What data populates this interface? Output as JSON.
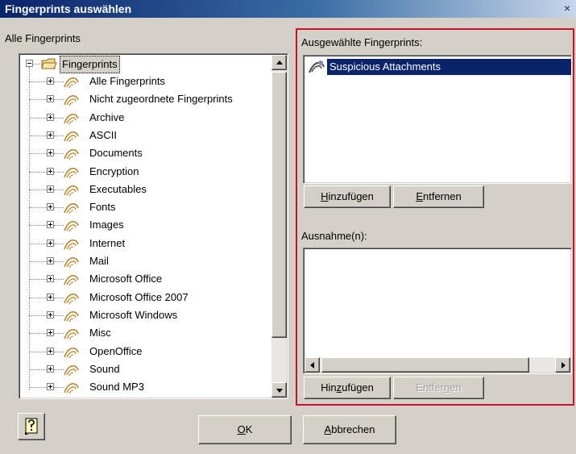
{
  "window": {
    "title": "Fingerprints auswählen",
    "close_glyph": "×"
  },
  "left": {
    "label": "Alle Fingerprints",
    "root": "Fingerprints",
    "items": [
      "Alle Fingerprints",
      "Nicht zugeordnete Fingerprints",
      "Archive",
      "ASCII",
      "Documents",
      "Encryption",
      "Executables",
      "Fonts",
      "Images",
      "Internet",
      "Mail",
      "Microsoft Office",
      "Microsoft Office 2007",
      "Microsoft Windows",
      "Misc",
      "OpenOffice",
      "Sound",
      "Sound MP3"
    ]
  },
  "selected": {
    "label": "Ausgewählte Fingerprints:",
    "items": [
      "Suspicious Attachments"
    ],
    "add_button": {
      "pre": "",
      "key": "H",
      "post": "inzufügen"
    },
    "remove_button": {
      "pre": "",
      "key": "E",
      "post": "ntfernen"
    }
  },
  "exceptions": {
    "label": "Ausnahme(n):",
    "add_button": {
      "pre": "Hin",
      "key": "z",
      "post": "ufügen"
    },
    "remove_button": {
      "pre": "Entfer",
      "key": "n",
      "post": "en"
    }
  },
  "footer": {
    "help_icon": "help-icon",
    "ok_button": {
      "pre": "",
      "key": "O",
      "post": "K"
    },
    "cancel_button": {
      "pre": "",
      "key": "A",
      "post": "bbrechen"
    }
  },
  "colors": {
    "highlight_border": "#c8102e",
    "selection": "#0a246a",
    "dialog_bg": "#d4d0c8"
  }
}
